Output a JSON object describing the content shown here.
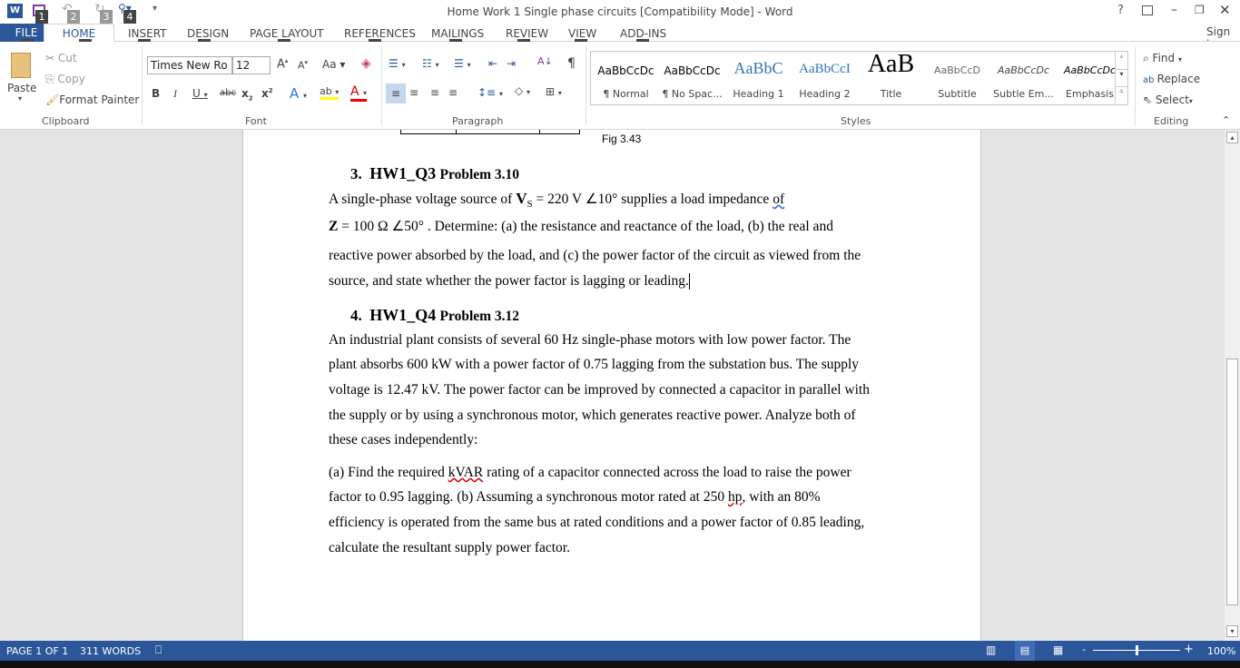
{
  "window": {
    "title": "Home Work 1 Single phase circuits [Compatibility Mode] - Word",
    "help": "?",
    "sign_in": "Sign in"
  },
  "qat_keytips": [
    "1",
    "2",
    "3",
    "4"
  ],
  "tabs": [
    {
      "label": "FILE",
      "key": "F"
    },
    {
      "label": "HOME",
      "key": "H"
    },
    {
      "label": "INSERT",
      "key": "N"
    },
    {
      "label": "DESIGN",
      "key": "G"
    },
    {
      "label": "PAGE LAYOUT",
      "key": "P"
    },
    {
      "label": "REFERENCES",
      "key": "S"
    },
    {
      "label": "MAILINGS",
      "key": "M"
    },
    {
      "label": "REVIEW",
      "key": "R"
    },
    {
      "label": "VIEW",
      "key": "W"
    },
    {
      "label": "ADD-INS",
      "key": "X"
    }
  ],
  "clipboard": {
    "paste": "Paste",
    "cut": "Cut",
    "copy": "Copy",
    "format_painter": "Format Painter",
    "label": "Clipboard"
  },
  "font": {
    "name": "Times New Ro",
    "size": "12",
    "change_case": "Aa",
    "label": "Font"
  },
  "paragraph": {
    "label": "Paragraph"
  },
  "styles": {
    "label": "Styles",
    "items": [
      {
        "preview": "AaBbCcDc",
        "name": "¶ Normal"
      },
      {
        "preview": "AaBbCcDc",
        "name": "¶ No Spac..."
      },
      {
        "preview": "AaBbC",
        "name": "Heading 1"
      },
      {
        "preview": "AaBbCcI",
        "name": "Heading 2"
      },
      {
        "preview": "AaB",
        "name": "Title"
      },
      {
        "preview": "AaBbCcD",
        "name": "Subtitle"
      },
      {
        "preview": "AaBbCcDc",
        "name": "Subtle Em..."
      },
      {
        "preview": "AaBbCcDc",
        "name": "Emphasis"
      }
    ]
  },
  "editing": {
    "find": "Find",
    "replace": "Replace",
    "select": "Select",
    "label": "Editing"
  },
  "document": {
    "fig_caption": "Fig 3.43",
    "q3": {
      "number": "3.",
      "title": "HW1_Q3",
      "subtitle": "Problem 3.10",
      "line1a": "A single-phase voltage source of ",
      "vs": "V",
      "vs_sub": "S",
      "line1b": " = 220 V ∠10°  supplies a load impedance ",
      "of": "of",
      "z": "Z",
      "line2": " = 100 Ω ∠50° .  Determine: (a) the resistance and reactance of the load, (b) the real and",
      "line3": "reactive power absorbed by the load, and (c) the power factor of the circuit as viewed from the",
      "line4": "source, and state whether the power factor is lagging or leading."
    },
    "q4": {
      "number": "4.",
      "title": "HW1_Q4",
      "subtitle": "Problem 3.12",
      "lines": [
        "An industrial plant consists of several 60 Hz single-phase motors with low power factor.  The",
        "plant absorbs 600 kW with a power factor of 0.75 lagging from the substation bus.  The supply",
        "voltage is 12.47 kV.  The power factor can be improved by connected a capacitor in parallel with",
        "the supply or by using a synchronous motor, which generates reactive power.  Analyze both of",
        "these cases independently:"
      ],
      "a_pre": "(a) Find the required ",
      "kvar": "kVAR",
      "a_post": " rating of a capacitor connected across the load to raise the power",
      "b1_pre": "factor to 0.95 lagging.  (b) Assuming a synchronous motor rated at 250 ",
      "hp": "hp",
      "b1_post": ", with an 80%",
      "b2": "efficiency is operated from the same bus at rated conditions and a power factor of 0.85 leading,",
      "b3": "calculate the resultant supply power factor."
    }
  },
  "status": {
    "page": "PAGE 1 OF 1",
    "words": "311 WORDS",
    "zoom": "100%",
    "zoom_percent": 100
  },
  "colors": {
    "accent": "#2b579a"
  }
}
